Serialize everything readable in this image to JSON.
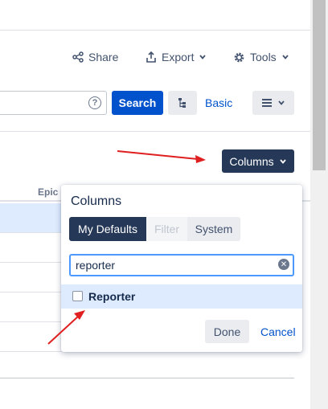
{
  "header": {
    "share_label": "Share",
    "export_label": "Export",
    "tools_label": "Tools"
  },
  "search": {
    "value": "",
    "search_label": "Search",
    "basic_label": "Basic"
  },
  "columns_button": {
    "label": "Columns"
  },
  "table": {
    "epic_header": "Epic I"
  },
  "column_picker": {
    "title": "Columns",
    "tabs": [
      "My Defaults",
      "Filter",
      "System"
    ],
    "filter_value": "reporter",
    "option_label": "Reporter",
    "done_label": "Done",
    "cancel_label": "Cancel"
  },
  "colors": {
    "primary": "#0052cc",
    "dark": "#253858",
    "highlight": "#deebff",
    "arrow": "#e02020"
  }
}
